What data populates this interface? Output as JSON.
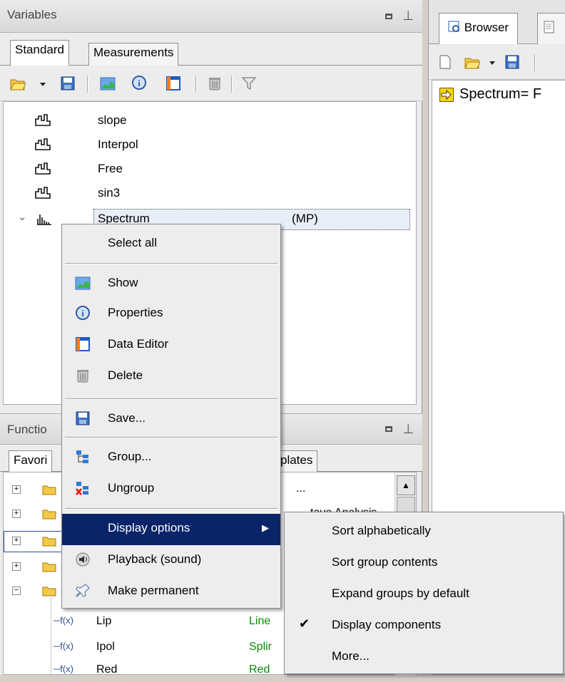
{
  "variables_panel": {
    "title": "Variables",
    "tabs": [
      "Standard",
      "Measurements"
    ],
    "toolbar_icons": [
      "open-folder-icon",
      "dropdown-arrow-icon",
      "save-icon",
      "show-chart-icon",
      "properties-icon",
      "data-editor-icon",
      "delete-icon",
      "filter-icon"
    ],
    "items": [
      {
        "name": "slope",
        "suffix": ""
      },
      {
        "name": "Interpol",
        "suffix": ""
      },
      {
        "name": "Free",
        "suffix": ""
      },
      {
        "name": "sin3",
        "suffix": ""
      },
      {
        "name": "Spectrum",
        "suffix": "(MP)"
      }
    ]
  },
  "functions_panel": {
    "title": "Functio",
    "tabs": [
      "Favori",
      "plates"
    ],
    "partial_texts": [
      "...",
      "tave Analysis"
    ],
    "function_items": [
      {
        "name": "Lip",
        "desc": "Line"
      },
      {
        "name": "Ipol",
        "desc": "Splir"
      },
      {
        "name": "Red",
        "desc": "Red"
      }
    ]
  },
  "right_panel": {
    "tabs": [
      "Browser",
      ""
    ],
    "line_text": "Spectrum= F"
  },
  "context_menu": {
    "items": [
      {
        "label": "Select all",
        "icon": ""
      },
      {
        "label": "Show",
        "icon": "show-chart-icon"
      },
      {
        "label": "Properties",
        "icon": "properties-icon"
      },
      {
        "label": "Data Editor",
        "icon": "data-editor-icon"
      },
      {
        "label": "Delete",
        "icon": "delete-icon"
      },
      {
        "label": "Save...",
        "icon": "save-icon"
      },
      {
        "label": "Group...",
        "icon": "group-icon"
      },
      {
        "label": "Ungroup",
        "icon": "ungroup-icon"
      },
      {
        "label": "Display options",
        "icon": ""
      },
      {
        "label": "Playback (sound)",
        "icon": "speaker-icon"
      },
      {
        "label": "Make permanent",
        "icon": "pin-icon"
      }
    ],
    "highlighted": "Display options"
  },
  "submenu": {
    "items": [
      {
        "label": "Sort alphabetically",
        "checked": false
      },
      {
        "label": "Sort group contents",
        "checked": false
      },
      {
        "label": "Expand groups by default",
        "checked": false
      },
      {
        "label": "Display components",
        "checked": true
      },
      {
        "label": "More...",
        "checked": false
      }
    ]
  },
  "colors": {
    "highlight": "#0a246a",
    "function_desc": "#0a8a0a",
    "arrow_icon": "#ffd700"
  }
}
